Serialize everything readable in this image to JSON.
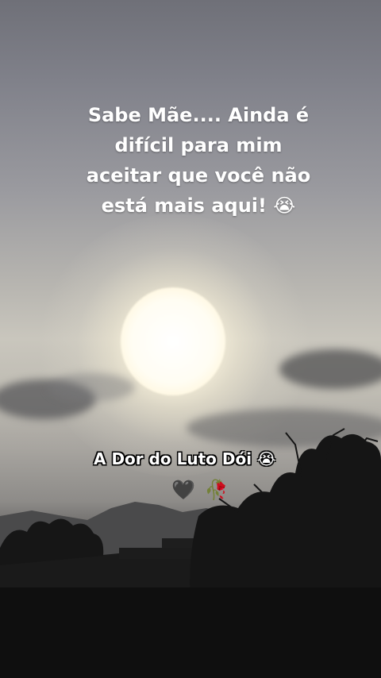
{
  "overlay_text": {
    "lines": [
      "Sabe Mãe.... Ainda é",
      "difícil para mim",
      "aceitar que você não",
      "está mais aqui! 😭"
    ],
    "caption": "A Dor do Luto Dói 😭",
    "emojis": [
      "🖤",
      "🥀"
    ]
  },
  "colors": {
    "sky_top": "#6f7078",
    "sky_horizon": "#c9c6bd",
    "sun": "#fffdf3",
    "silhouette": "#141414",
    "text": "#ffffff",
    "caption_outline": "#000000"
  }
}
